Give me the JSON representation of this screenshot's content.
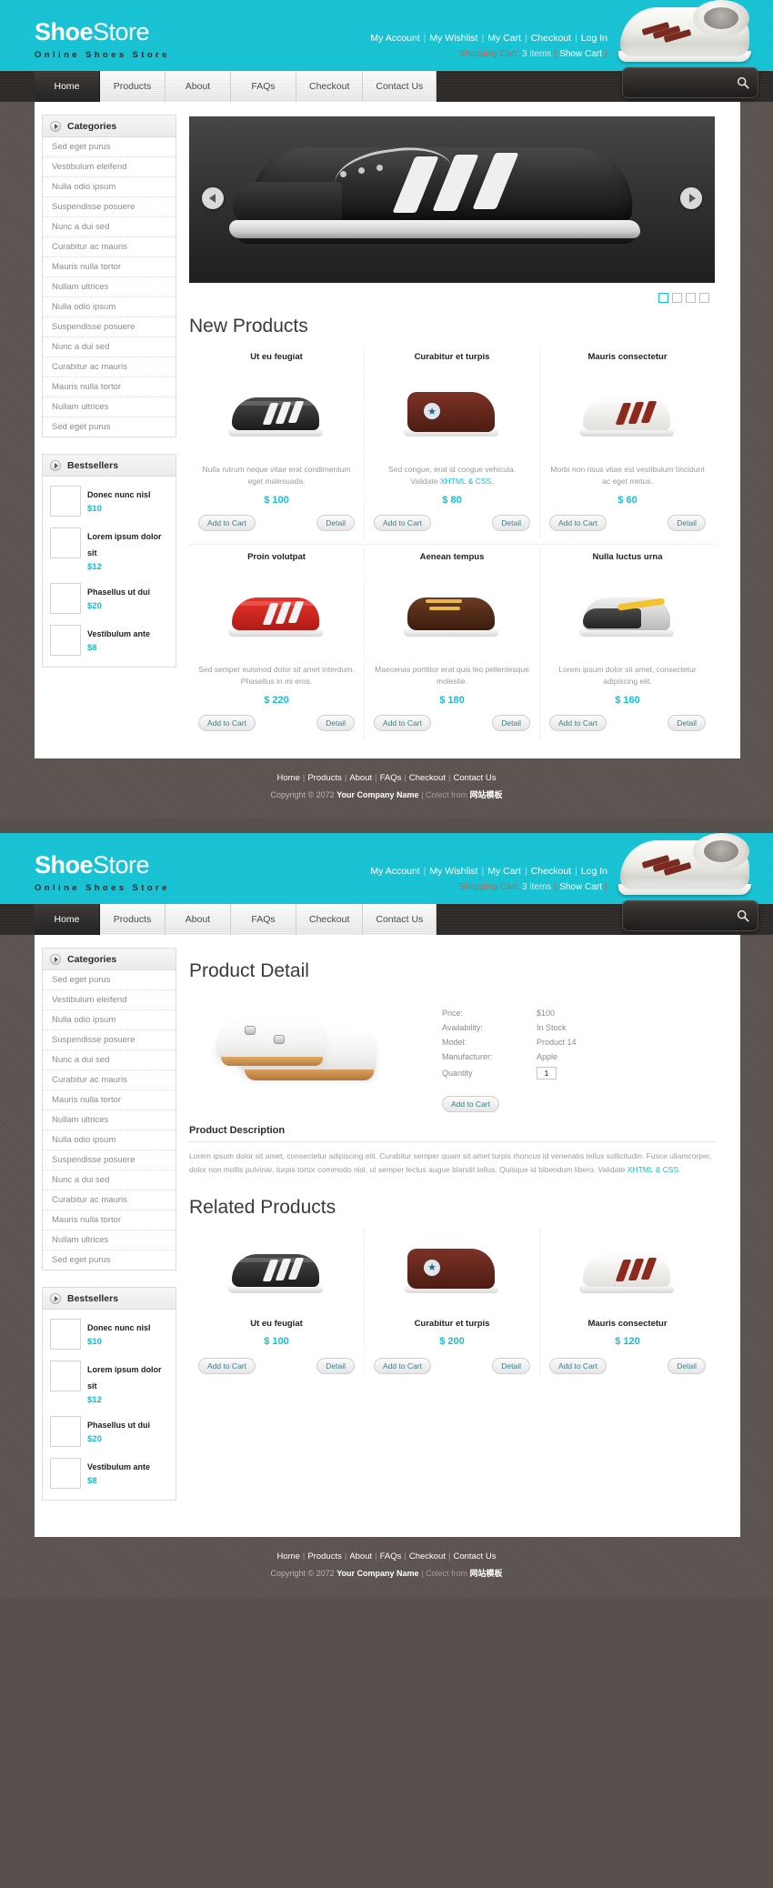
{
  "brand": {
    "name_bold": "Shoe",
    "name_thin": "Store",
    "tagline": "Online Shoes Store"
  },
  "utility_links": [
    "My Account",
    "My Wishlist",
    "My Cart",
    "Checkout",
    "Log In"
  ],
  "cart": {
    "label": "Shopping Cart:",
    "items": "3 items",
    "open_paren": "(",
    "show": "Show Cart",
    "close_paren": ")"
  },
  "nav": {
    "items": [
      "Home",
      "Products",
      "About",
      "FAQs",
      "Checkout",
      "Contact Us"
    ],
    "active": "Home"
  },
  "search": {
    "placeholder": "",
    "value": "",
    "icon": "search-icon"
  },
  "sidebar": {
    "categories": {
      "title": "Categories",
      "items": [
        "Sed eget purus",
        "Vestibulum eleifend",
        "Nulla odio ipsum",
        "Suspendisse posuere",
        "Nunc a dui sed",
        "Curabitur ac mauris",
        "Mauris nulla tortor",
        "Nullam ultrices",
        "Nulla odio ipsum",
        "Suspendisse posuere",
        "Nunc a dui sed",
        "Curabitur ac mauris",
        "Mauris nulla tortor",
        "Nullam ultrices",
        "Sed eget purus"
      ]
    },
    "bestsellers": {
      "title": "Bestsellers",
      "items": [
        {
          "name": "Donec nunc nisl",
          "price": "$10"
        },
        {
          "name": "Lorem ipsum dolor sit",
          "price": "$12"
        },
        {
          "name": "Phasellus ut dui",
          "price": "$20"
        },
        {
          "name": "Vestibulum ante",
          "price": "$8"
        }
      ]
    }
  },
  "home": {
    "slider": {
      "prev_icon": "chevron-left-icon",
      "next_icon": "chevron-right-icon",
      "dots": 4,
      "active_dot": 0
    },
    "section_title": "New Products",
    "products_row1": [
      {
        "name": "Ut eu feugiat",
        "desc": "Nulla rutrum neque vitae erat condimentum eget malesuada.",
        "desc_link": "",
        "price": "$ 100",
        "add": "Add to Cart",
        "detail": "Detail",
        "sprite": "black"
      },
      {
        "name": "Curabitur et turpis",
        "desc": "Sed congue, erat id congue vehicula. Validate ",
        "desc_link": "XHTML & CSS",
        "desc_tail": ".",
        "price": "$ 80",
        "add": "Add to Cart",
        "detail": "Detail",
        "sprite": "brown"
      },
      {
        "name": "Mauris consectetur",
        "desc": "Morbi non risus vitae est vestibulum tincidunt ac eget metus.",
        "desc_link": "",
        "price": "$ 60",
        "add": "Add to Cart",
        "detail": "Detail",
        "sprite": "white"
      }
    ],
    "products_row2": [
      {
        "name": "Proin volutpat",
        "desc": "Sed semper euismod dolor sit amet interdum. Phasellus in mi eros.",
        "desc_link": "",
        "price": "$ 220",
        "add": "Add to Cart",
        "detail": "Detail",
        "sprite": "red"
      },
      {
        "name": "Aenean tempus",
        "desc": "Maecenas porttitor erat quis leo pellentesque molestie.",
        "desc_link": "",
        "price": "$ 180",
        "add": "Add to Cart",
        "detail": "Detail",
        "sprite": "boot"
      },
      {
        "name": "Nulla luctus urna",
        "desc": "Lorem ipsum dolor sit amet, consectetur adipiscing elit.",
        "desc_link": "",
        "price": "$ 160",
        "add": "Add to Cart",
        "detail": "Detail",
        "sprite": "grey"
      }
    ]
  },
  "detail_page": {
    "title": "Product Detail",
    "specs": [
      {
        "key": "Price:",
        "value": "$100"
      },
      {
        "key": "Availability:",
        "value": "In Stock"
      },
      {
        "key": "Model:",
        "value": "Product 14"
      },
      {
        "key": "Manufacturer:",
        "value": "Apple"
      }
    ],
    "quantity_label": "Quantity",
    "quantity_value": "1",
    "add_to_cart": "Add to Cart",
    "description_title": "Product Description",
    "description_text_1": "Lorem ipsum dolor sit amet, consectetur adipiscing elit. Curabitur semper quam sit amet turpis rhoncus id venenatis tellus sollicitudin. Fusce ullamcorper, dolor non mollis pulvinar, turpis tortor commodo nisl, ut semper lectus augue blandit tellus. Quisque id bibendum libero. Validate ",
    "description_link": "XHTML & CSS",
    "description_text_2": ".",
    "related_title": "Related Products",
    "related": [
      {
        "name": "Ut eu feugiat",
        "price": "$ 100",
        "add": "Add to Cart",
        "detail": "Detail",
        "sprite": "black"
      },
      {
        "name": "Curabitur et turpis",
        "price": "$ 200",
        "add": "Add to Cart",
        "detail": "Detail",
        "sprite": "brown"
      },
      {
        "name": "Mauris consectetur",
        "price": "$ 120",
        "add": "Add to Cart",
        "detail": "Detail",
        "sprite": "white"
      }
    ]
  },
  "footer": {
    "links": [
      "Home",
      "Products",
      "About",
      "FAQs",
      "Checkout",
      "Contact Us"
    ],
    "copyright_prefix": "Copyright © 2072",
    "company": "Your Company Name",
    "collect_from": "Colect from",
    "collect_source": "网站模板"
  },
  "colors": {
    "accent": "#17c0d1",
    "link": "#17bdd0",
    "dark": "#2d2a28",
    "page_bg": "#57504c"
  }
}
